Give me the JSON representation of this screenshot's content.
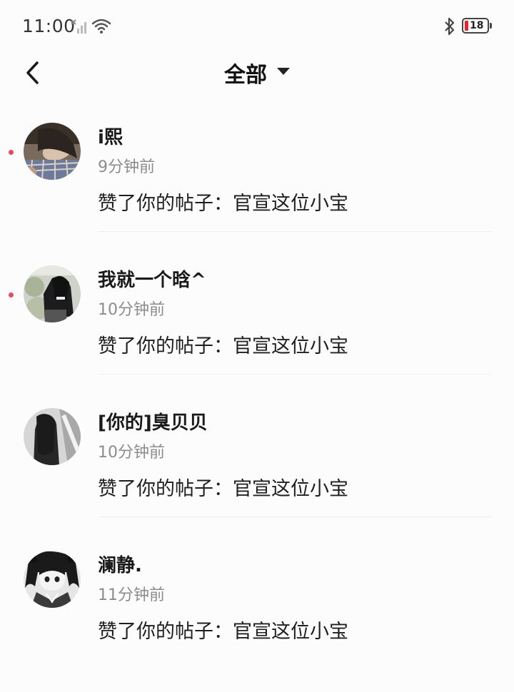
{
  "status_bar": {
    "time": "11:00",
    "battery_level": "18",
    "icons": [
      "signal-no-sim-icon",
      "wifi-icon",
      "bluetooth-icon",
      "battery-icon"
    ]
  },
  "header": {
    "back_icon": "chevron-left-icon",
    "title": "全部",
    "dropdown_icon": "caret-down-icon"
  },
  "notifications": [
    {
      "name": "i熙",
      "time": "9分钟前",
      "message": "赞了你的帖子：官宣这位小宝",
      "unread": true
    },
    {
      "name": "我就一个晗^",
      "time": "10分钟前",
      "message": "赞了你的帖子：官宣这位小宝",
      "unread": true
    },
    {
      "name": "[你的]臭贝贝",
      "time": "10分钟前",
      "message": "赞了你的帖子：官宣这位小宝",
      "unread": false
    },
    {
      "name": "澜静.",
      "time": "11分钟前",
      "message": "赞了你的帖子：官宣这位小宝",
      "unread": false
    }
  ],
  "colors": {
    "unread_dot": "#e84a5f",
    "battery_low": "#e8232b",
    "secondary_text": "#8c8c8c"
  }
}
